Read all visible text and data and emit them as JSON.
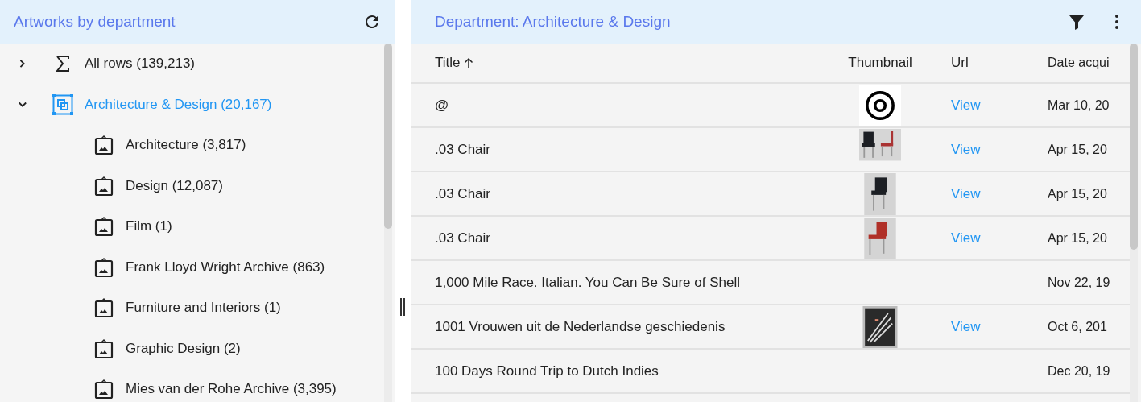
{
  "left_panel": {
    "title": "Artworks by department",
    "tree": [
      {
        "kind": "total",
        "label": "All rows (139,213)",
        "expanded": false,
        "selected": false
      },
      {
        "kind": "department",
        "label": "Architecture & Design (20,167)",
        "expanded": true,
        "selected": true,
        "children": [
          {
            "kind": "collection",
            "label": "Architecture (3,817)",
            "selected": false
          },
          {
            "kind": "collection",
            "label": "Design (12,087)",
            "selected": false
          },
          {
            "kind": "collection",
            "label": "Film (1)",
            "selected": false
          },
          {
            "kind": "collection",
            "label": "Frank Lloyd Wright Archive (863)",
            "selected": false
          },
          {
            "kind": "collection",
            "label": "Furniture and Interiors (1)",
            "selected": false
          },
          {
            "kind": "collection",
            "label": "Graphic Design (2)",
            "selected": false
          },
          {
            "kind": "collection",
            "label": "Mies van der Rohe Archive (3,395)",
            "selected": false
          }
        ]
      }
    ]
  },
  "right_panel": {
    "title": "Department: Architecture & Design",
    "table": {
      "columns": [
        {
          "label": "Title",
          "sorted": true
        },
        {
          "label": "Thumbnail",
          "sorted": false
        },
        {
          "label": "Url",
          "sorted": false
        },
        {
          "label": "Date acqui",
          "sorted": false
        }
      ],
      "rows": [
        {
          "title": "@",
          "url": "View",
          "date": "Mar 10, 20"
        },
        {
          "title": ".03 Chair",
          "url": "View",
          "date": "Apr 15, 20"
        },
        {
          "title": ".03 Chair",
          "url": "View",
          "date": "Apr 15, 20"
        },
        {
          "title": ".03 Chair",
          "url": "View",
          "date": "Apr 15, 20"
        },
        {
          "title": "1,000 Mile Race. Italian. You Can Be Sure of Shell",
          "date": "Nov 22, 19"
        },
        {
          "title": "1001 Vrouwen uit de Nederlandse geschiedenis",
          "url": "View",
          "date": "Oct 6, 201"
        },
        {
          "title": "100 Days Round Trip to Dutch Indies",
          "date": "Dec 20, 19"
        }
      ]
    }
  }
}
